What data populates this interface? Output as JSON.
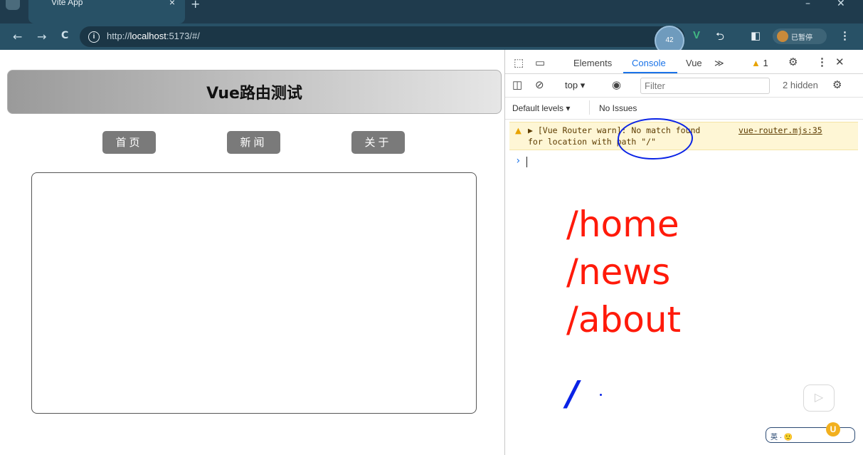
{
  "browser": {
    "tab_title": "Vite App",
    "tab_close": "×",
    "new_tab": "+",
    "minimize": "–",
    "close": "✕",
    "back": "←",
    "forward": "→",
    "reload": "C",
    "info_icon": "i",
    "url_prefix": "http://",
    "url_host": "localhost",
    "url_rest": ":5173/#/",
    "extension_badge": "42",
    "ext_v": "V",
    "ext_puzzle": "⮌",
    "sidebar_icon": "◧",
    "profile_label": "已暂停",
    "menu": "⋮"
  },
  "page": {
    "title": "Vue路由测试",
    "nav": [
      {
        "label": "首页"
      },
      {
        "label": "新闻"
      },
      {
        "label": "关于"
      }
    ]
  },
  "devtools": {
    "tabs": [
      "Elements",
      "Console",
      "Vue"
    ],
    "more_tabs": "≫",
    "warning_count": "1",
    "warning_icon": "▲",
    "context": "top",
    "context_arrow": "▾",
    "filter_placeholder": "Filter",
    "hidden": "2 hidden",
    "levels": "Default levels ▾",
    "issues": "No Issues",
    "warning": {
      "line1": "▶ [Vue Router warn]: No match found",
      "line2": "for location with path \"/\"",
      "source": "vue-router.mjs:35"
    },
    "prompt": "›"
  },
  "annotations": {
    "lines": [
      "/home",
      "/news",
      "/about"
    ],
    "slash": "/",
    "colors": {
      "red": "#ff1a0a",
      "blue": "#0a23e6"
    }
  },
  "widgets": {
    "play_icon": "▷",
    "corner_text": "英 · 🙂",
    "corner_logo": "U"
  }
}
